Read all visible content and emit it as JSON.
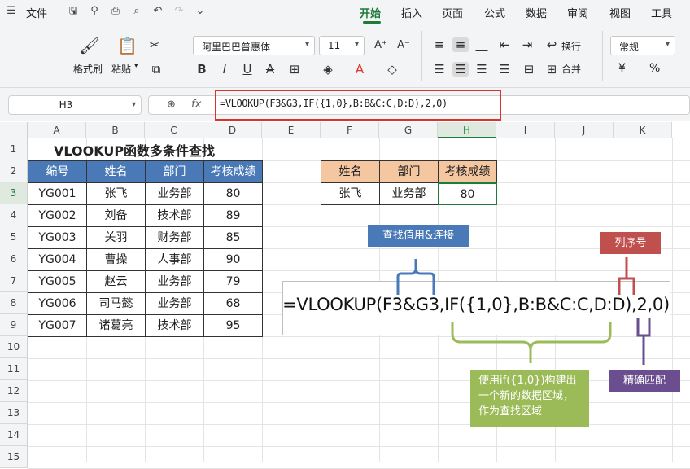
{
  "menubar": {
    "file_label": "文件",
    "tabs": [
      "开始",
      "插入",
      "页面",
      "公式",
      "数据",
      "审阅",
      "视图",
      "工具"
    ],
    "active_tab": "开始"
  },
  "ribbon": {
    "format_painter": "格式刷",
    "paste": "粘贴",
    "font_name": "阿里巴巴普惠体",
    "font_size": "11",
    "wrap": "换行",
    "merge": "合并",
    "number_format": "常规",
    "currency": "¥",
    "percent": "%"
  },
  "formula_bar": {
    "name_box": "H3",
    "fx": "fx",
    "formula": "=VLOOKUP(F3&G3,IF({1,0},B:B&C:C,D:D),2,0)"
  },
  "sheet": {
    "columns": [
      "A",
      "B",
      "C",
      "D",
      "E",
      "F",
      "G",
      "H",
      "I",
      "J",
      "K"
    ],
    "rows": [
      "1",
      "2",
      "3",
      "4",
      "5",
      "6",
      "7",
      "8",
      "9",
      "10",
      "11",
      "12",
      "13",
      "14",
      "15"
    ],
    "selected_cell": "H3",
    "title": "VLOOKUP函数多条件查找",
    "table_headers": [
      "编号",
      "姓名",
      "部门",
      "考核成绩"
    ],
    "table_rows": [
      [
        "YG001",
        "张飞",
        "业务部",
        "80"
      ],
      [
        "YG002",
        "刘备",
        "技术部",
        "89"
      ],
      [
        "YG003",
        "关羽",
        "财务部",
        "85"
      ],
      [
        "YG004",
        "曹操",
        "人事部",
        "90"
      ],
      [
        "YG005",
        "赵云",
        "业务部",
        "79"
      ],
      [
        "YG006",
        "司马懿",
        "业务部",
        "68"
      ],
      [
        "YG007",
        "诸葛亮",
        "技术部",
        "95"
      ]
    ],
    "lookup_headers": [
      "姓名",
      "部门",
      "考核成绩"
    ],
    "lookup_row": [
      "张飞",
      "业务部",
      "80"
    ]
  },
  "annotation": {
    "formula": "=VLOOKUP(F3&G3,IF({1,0},B:B&C:C,D:D),2,0)",
    "lookup_value_label": "查找值用&连接",
    "col_index_label": "列序号",
    "exact_match_label": "精确匹配",
    "if_note": "使用if({1,0})构建出一个新的数据区域，作为查找区域",
    "colors": {
      "blue": "#4a79b8",
      "red": "#c0504d",
      "purple": "#6b4e8f",
      "green": "#9bbb59"
    }
  }
}
